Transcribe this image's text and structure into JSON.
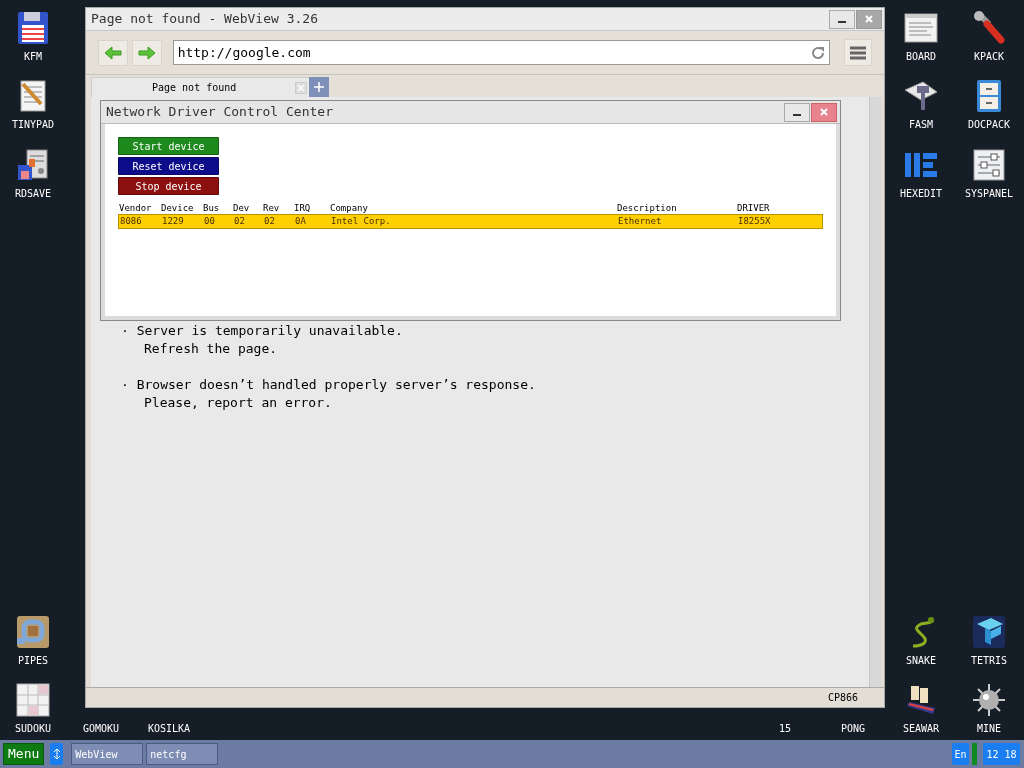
{
  "desktop_icons": [
    {
      "label": "KFM",
      "kind": "floppy"
    },
    {
      "label": "TINYPAD",
      "kind": "notepad"
    },
    {
      "label": "RDSAVE",
      "kind": "disk-save"
    },
    {
      "label": "PIPES",
      "kind": "pipes"
    },
    {
      "label": "SUDOKU",
      "kind": "sudoku"
    },
    {
      "label": "GOMOKU",
      "kind": "hidden"
    },
    {
      "label": "KOSILKA",
      "kind": "hidden"
    },
    {
      "label": "15",
      "kind": "hidden"
    },
    {
      "label": "PONG",
      "kind": "hidden"
    },
    {
      "label": "BOARD",
      "kind": "board"
    },
    {
      "label": "KPACK",
      "kind": "wrench"
    },
    {
      "label": "FASM",
      "kind": "hammer"
    },
    {
      "label": "DOCPACK",
      "kind": "cabinet"
    },
    {
      "label": "HEXEDIT",
      "kind": "hexedit"
    },
    {
      "label": "SYSPANEL",
      "kind": "sliders"
    },
    {
      "label": "SNAKE",
      "kind": "snake"
    },
    {
      "label": "TETRIS",
      "kind": "blocks"
    },
    {
      "label": "SEAWAR",
      "kind": "ship"
    },
    {
      "label": "MINE",
      "kind": "mine"
    }
  ],
  "browser": {
    "title": "Page not found - WebView 3.26",
    "url": "http://google.com",
    "tabs": [
      {
        "label": "Page not found",
        "selected": true
      }
    ],
    "messages": [
      {
        "lines": [
          "· Server is temporarily unavailable.",
          "Refresh the page."
        ]
      },
      {
        "lines": [
          "· Browser doesn’t handled properly server’s response.",
          "Please, report an error."
        ]
      }
    ],
    "status": "CP866"
  },
  "dialog": {
    "title": "Network Driver Control Center",
    "buttons": [
      {
        "label": "Start device",
        "color": "#1e8a1e"
      },
      {
        "label": "Reset device",
        "color": "#0d0d8c"
      },
      {
        "label": "Stop device",
        "color": "#8c1010"
      }
    ],
    "columns": [
      "Vendor",
      "Device",
      "Bus",
      "Dev",
      "Rev",
      "IRQ",
      "Company",
      "Description",
      "DRIVER"
    ],
    "rows": [
      {
        "cells": [
          "8086",
          "1229",
          "00",
          "02",
          "02",
          "0A",
          "Intel Corp.",
          "Ethernet",
          "I8255X"
        ],
        "selected": true
      }
    ]
  },
  "taskbar": {
    "menu": "Menu",
    "tasks": [
      "WebView",
      "netcfg"
    ],
    "language": "En",
    "clock": "12 18"
  }
}
